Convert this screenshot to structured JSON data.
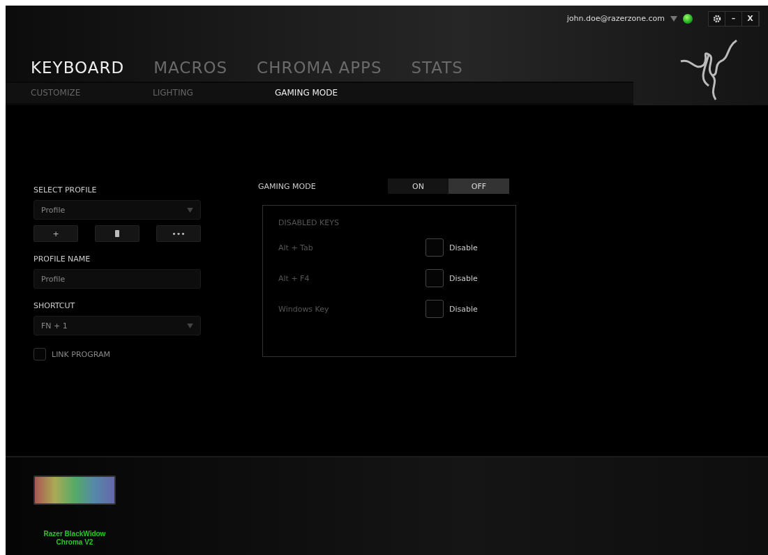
{
  "account": {
    "email": "john.doe@razerzone.com",
    "online": true
  },
  "window_buttons": [
    {
      "kind": "settings"
    },
    {
      "kind": "text",
      "label": "–"
    },
    {
      "kind": "text",
      "label": "X"
    }
  ],
  "tabs": [
    {
      "label": "KEYBOARD",
      "selected": true
    },
    {
      "label": "MACROS",
      "selected": false
    },
    {
      "label": "CHROMA APPS",
      "selected": false
    },
    {
      "label": "STATS",
      "selected": false
    }
  ],
  "subtabs": [
    {
      "label": "CUSTOMIZE",
      "selected": false
    },
    {
      "label": "LIGHTING",
      "selected": false
    },
    {
      "label": "GAMING MODE",
      "selected": true
    }
  ],
  "profile": {
    "select_label": "SELECT PROFILE",
    "selected_profile": "Profile",
    "actions": [
      {
        "kind": "text",
        "label": "+"
      },
      {
        "kind": "trash"
      },
      {
        "kind": "text",
        "label": "•••"
      }
    ],
    "name_label": "PROFILE NAME",
    "name_value": "Profile",
    "shortcut_label": "SHORTCUT",
    "shortcut_value": "FN + 1",
    "link_program": {
      "label": "LINK PROGRAM",
      "checked": false
    }
  },
  "gaming_mode": {
    "label": "GAMING MODE",
    "options": [
      {
        "label": "ON",
        "selected": false
      },
      {
        "label": "OFF",
        "selected": true
      }
    ]
  },
  "disabled_keys": {
    "title": "DISABLED KEYS",
    "rows": [
      {
        "key": "Alt + Tab",
        "option": "Disable",
        "checked": false
      },
      {
        "key": "Alt + F4",
        "option": "Disable",
        "checked": false
      },
      {
        "key": "Windows Key",
        "option": "Disable",
        "checked": false
      }
    ]
  },
  "device": {
    "name": "Razer BlackWidow Chroma V2"
  }
}
